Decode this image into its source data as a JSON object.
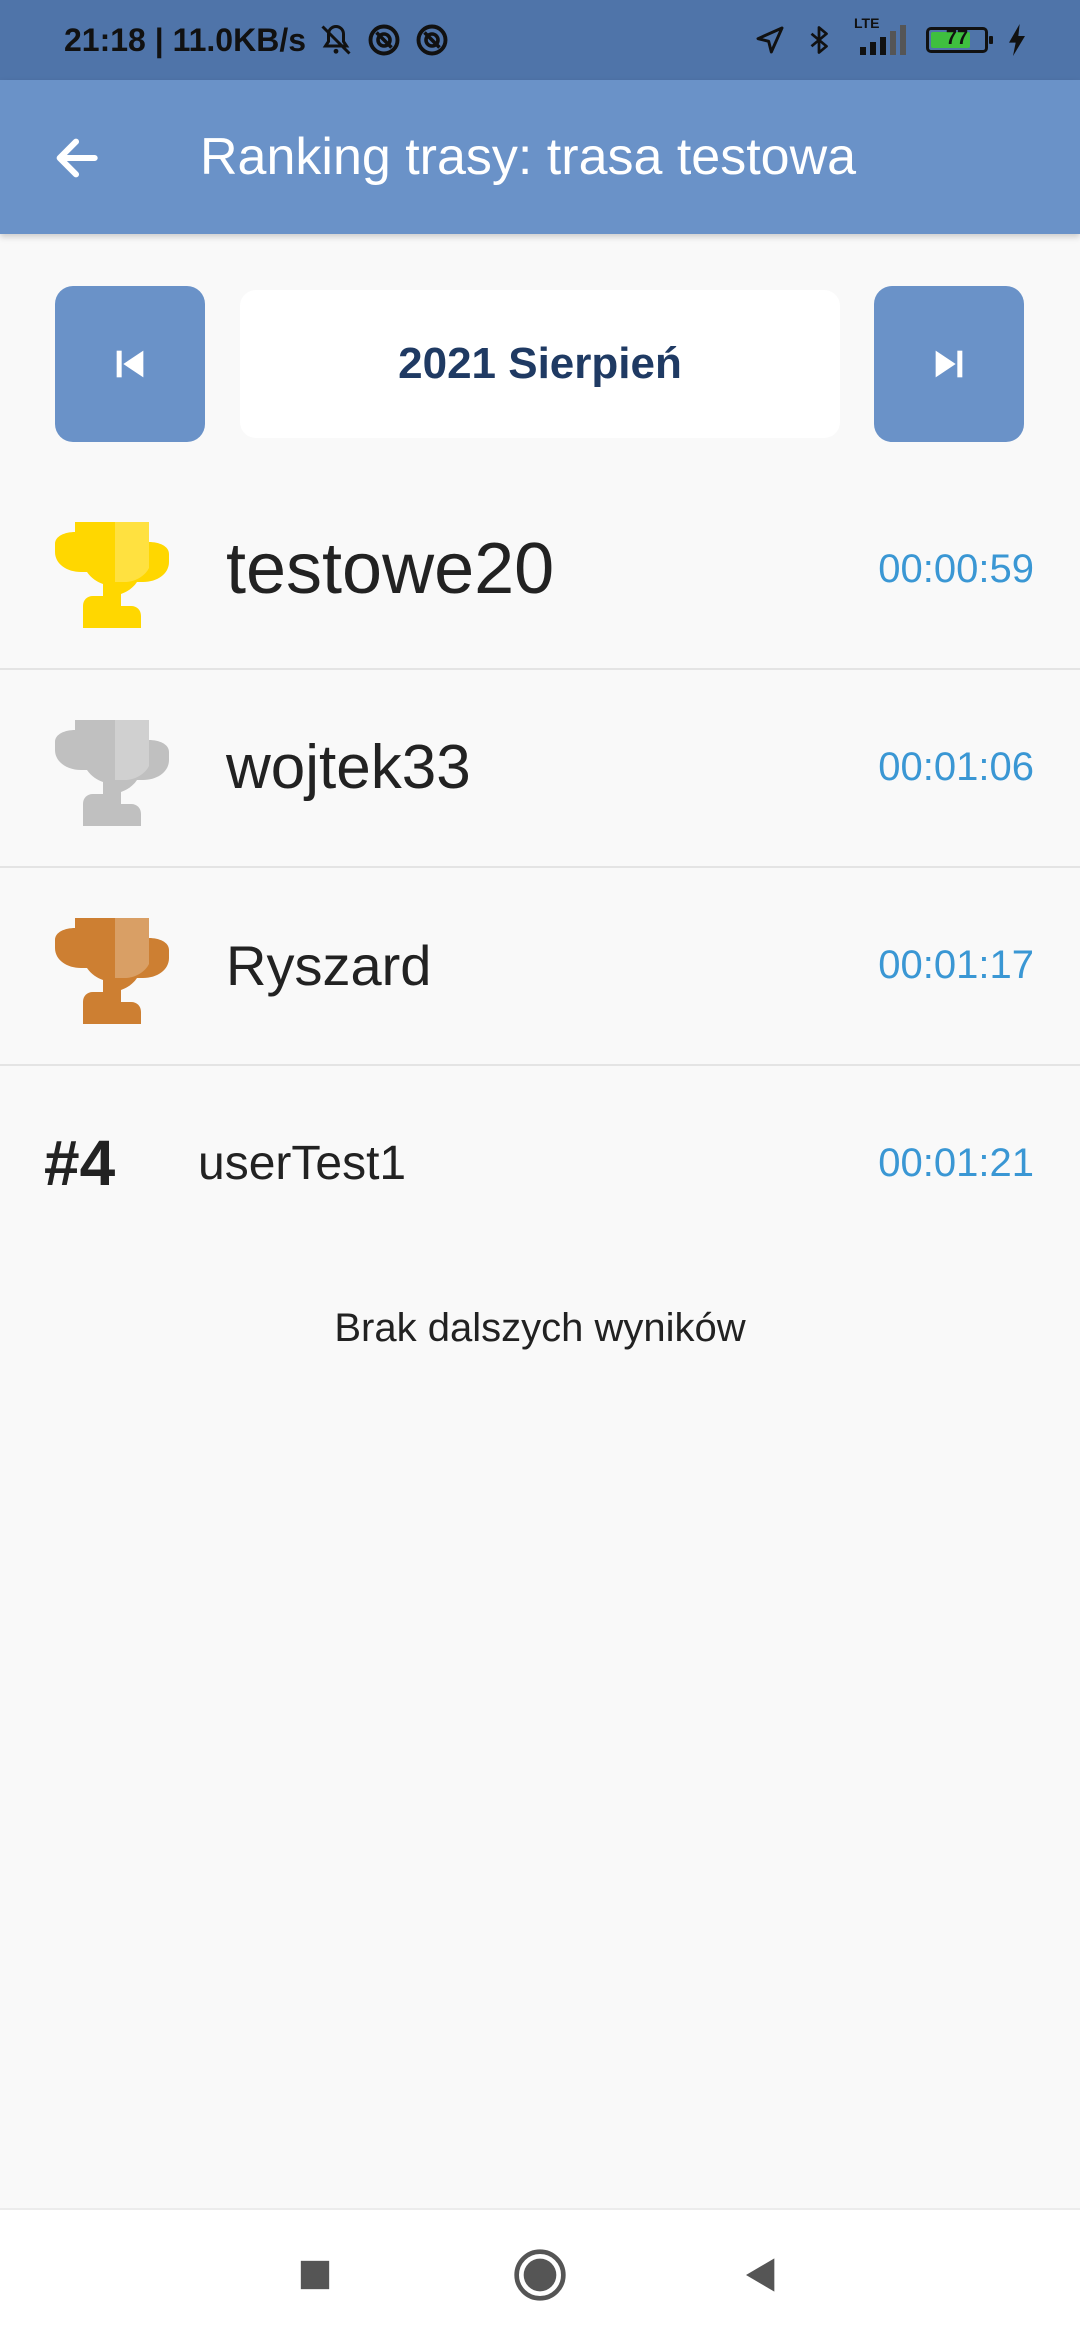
{
  "status_bar": {
    "time_speed": "21:18 | 11.0KB/s",
    "network_label": "LTE",
    "battery_level": "77",
    "battery_fraction": 0.77,
    "icons": [
      "muted-bell-icon",
      "data-saver-icon",
      "data-saver-icon",
      "location-arrow-icon",
      "bluetooth-icon",
      "signal-icon",
      "battery-icon",
      "charging-icon"
    ]
  },
  "app_bar": {
    "title": "Ranking trasy: trasa testowa",
    "back_icon": "arrow-left-icon"
  },
  "month_selector": {
    "label": "2021 Sierpień",
    "prev_icon": "skip-previous-icon",
    "next_icon": "skip-next-icon"
  },
  "ranking": [
    {
      "place": 1,
      "name": "testowe20",
      "time": "00:00:59",
      "trophy_color": "#ffd700"
    },
    {
      "place": 2,
      "name": "wojtek33",
      "time": "00:01:06",
      "trophy_color": "#c0c0c0"
    },
    {
      "place": 3,
      "name": "Ryszard",
      "time": "00:01:17",
      "trophy_color": "#cd7f32"
    },
    {
      "place_label": "#4",
      "name": "userTest1",
      "time": "00:01:21"
    }
  ],
  "no_more_results": "Brak dalszych wyników",
  "colors": {
    "app_bar": "#6a92c8",
    "status_bar": "#4f74a9",
    "time_text": "#3a97d4",
    "month_text": "#1f3a63"
  },
  "nav_bar": {
    "icons": [
      "recents-square-icon",
      "home-circle-icon",
      "back-triangle-icon"
    ]
  }
}
